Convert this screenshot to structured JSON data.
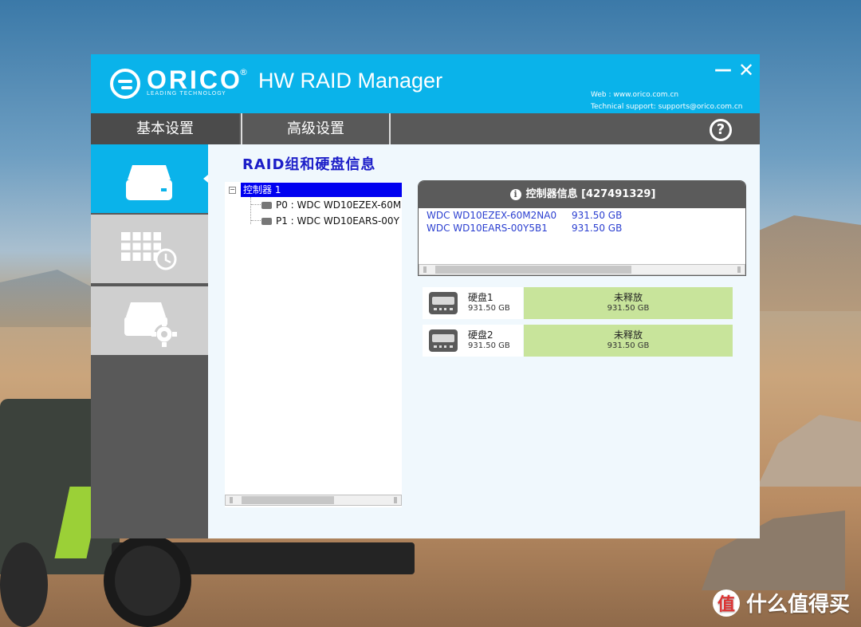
{
  "window": {
    "brand": "ORICO",
    "brand_mark": "®",
    "brand_tagline": "LEADING TECHNOLOGY",
    "title": "HW RAID Manager",
    "web": "Web : www.orico.com.cn",
    "support": "Technical support: supports@orico.com.cn",
    "minimize_symbol": "—",
    "close_symbol": "✕"
  },
  "tabs": [
    {
      "label": "基本设置",
      "active": true
    },
    {
      "label": "高级设置",
      "active": false
    }
  ],
  "help": {
    "symbol": "?",
    "icon": "help-icon"
  },
  "sidebar": {
    "items": [
      {
        "icon": "hard-drive-icon",
        "active": true
      },
      {
        "icon": "raid-grid-clock-icon",
        "active": false
      },
      {
        "icon": "drive-settings-icon",
        "active": false
      }
    ]
  },
  "content": {
    "title": "RAID组和硬盘信息"
  },
  "tree": {
    "expander": "−",
    "root": "控制器 1",
    "items": [
      "P0 : WDC WD10EZEX-60M",
      "P1 : WDC WD10EARS-00Y"
    ]
  },
  "controller_info": {
    "header": "控制器信息  [427491329]",
    "icon": "info-icon",
    "disks": [
      {
        "model": "WDC WD10EZEX-60M2NA0",
        "size": "931.50 GB"
      },
      {
        "model": "WDC WD10EARS-00Y5B1",
        "size": "931.50 GB"
      }
    ]
  },
  "disk_cards": [
    {
      "name": "硬盘1",
      "size": "931.50 GB",
      "status": "未释放",
      "status_size": "931.50 GB"
    },
    {
      "name": "硬盘2",
      "size": "931.50 GB",
      "status": "未释放",
      "status_size": "931.50 GB"
    }
  ],
  "watermark": {
    "logo": "值",
    "text": "什么值得买"
  },
  "colors": {
    "titlebar": "#0ab3ea",
    "tabbar": "#595959",
    "tree_selected": "#0000f0",
    "content_title": "#1c1ec8",
    "disk_text": "#2b3fd0",
    "card_status_bg": "#c8e49b"
  }
}
